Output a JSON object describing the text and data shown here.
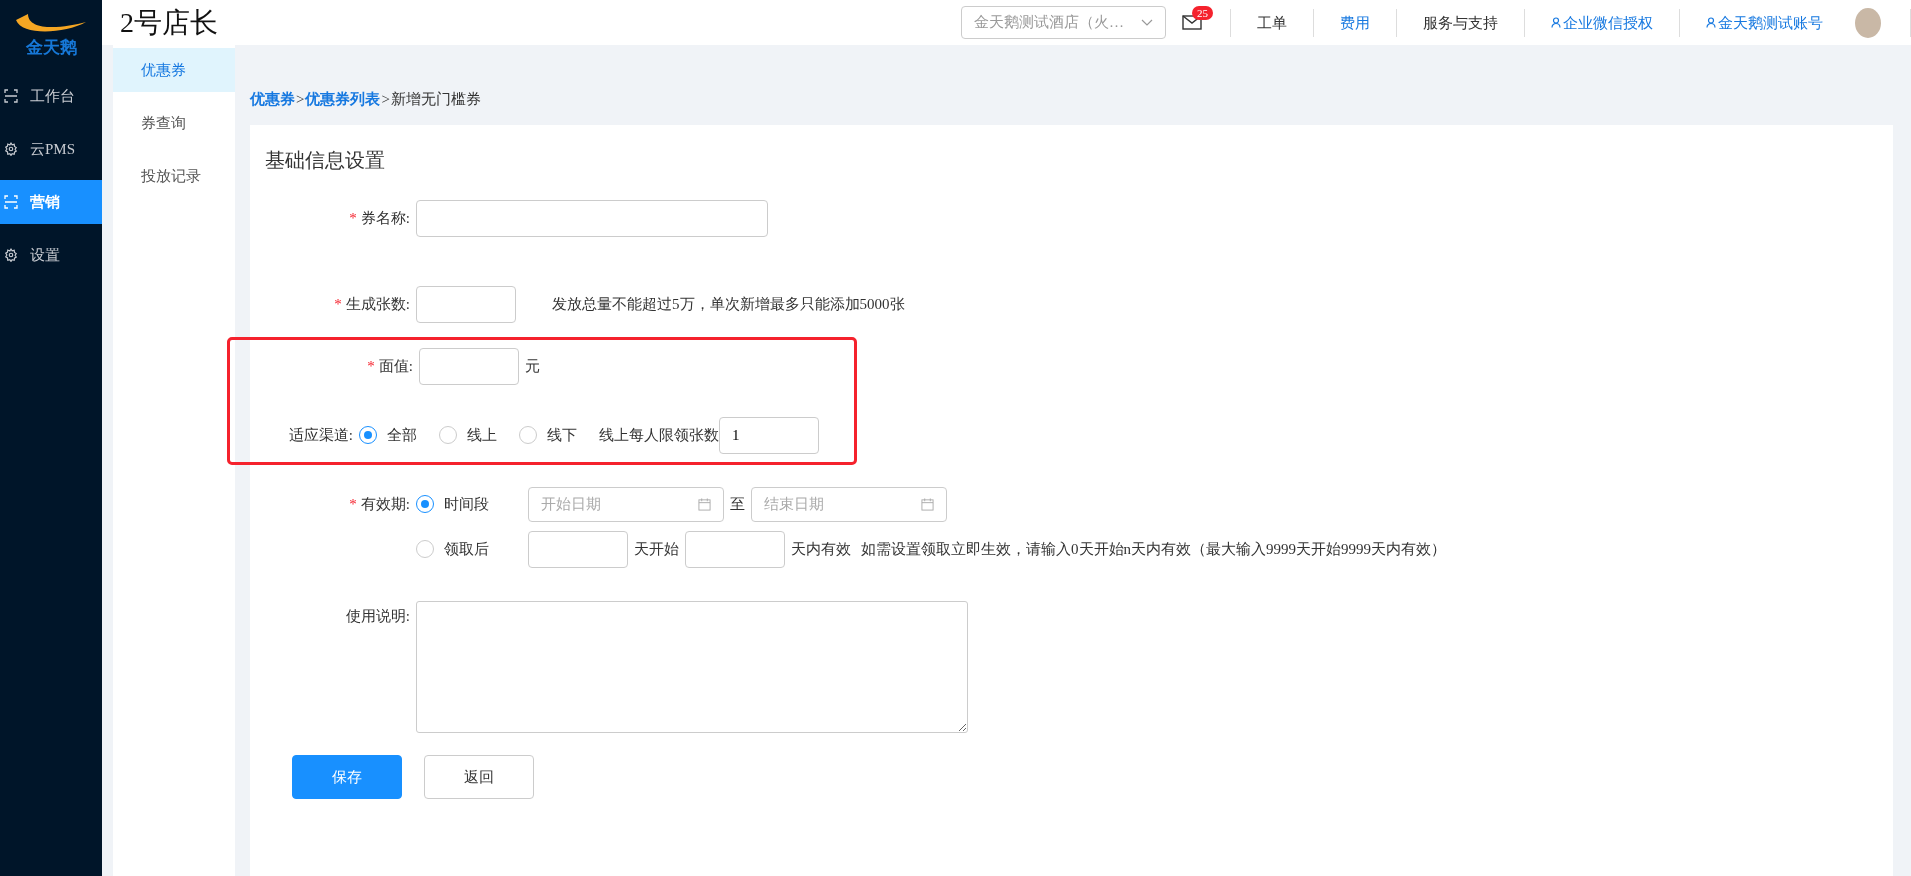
{
  "logo": {
    "text": "金天鹅"
  },
  "app_title": "2号店长",
  "header": {
    "store_select": {
      "value": "金天鹅测试酒店（火…"
    },
    "mail_badge": "25",
    "links": [
      {
        "label": "工单",
        "kind": "plain"
      },
      {
        "label": "费用",
        "kind": "active"
      },
      {
        "label": "服务与支持",
        "kind": "plain"
      },
      {
        "label": "企业微信授权",
        "kind": "user"
      },
      {
        "label": "金天鹅测试账号",
        "kind": "user"
      }
    ]
  },
  "sidebar": {
    "items": [
      {
        "label": "工作台",
        "kind": "scan",
        "selected": false
      },
      {
        "label": "云PMS",
        "kind": "gear",
        "selected": false
      },
      {
        "label": "营销",
        "kind": "scan",
        "selected": true
      },
      {
        "label": "设置",
        "kind": "gear",
        "selected": false
      }
    ]
  },
  "submenu": {
    "items": [
      {
        "label": "优惠券",
        "selected": true
      },
      {
        "label": "券查询",
        "selected": false
      },
      {
        "label": "投放记录",
        "selected": false
      }
    ]
  },
  "breadcrumb_separator": ">",
  "breadcrumb": [
    {
      "label": "优惠券",
      "kind": "link"
    },
    {
      "label": "优惠券列表",
      "kind": "link"
    },
    {
      "label": "新增无门槛券",
      "kind": "current"
    }
  ],
  "form": {
    "title": "基础信息设置",
    "required_mark": "*",
    "name": {
      "label": "券名称:",
      "required": true
    },
    "count": {
      "label": "生成张数:",
      "required": true,
      "hint": "发放总量不能超过5万，单次新增最多只能添加5000张"
    },
    "value": {
      "label": "面值:",
      "required": true,
      "unit": "元"
    },
    "channel": {
      "label": "适应渠道:",
      "options": [
        {
          "label": "全部",
          "selected": true
        },
        {
          "label": "线上",
          "selected": false
        },
        {
          "label": "线下",
          "selected": false
        }
      ],
      "limit_label": "线上每人限领张数",
      "limit_value": "1"
    },
    "validity": {
      "label": "有效期:",
      "required": true,
      "range": {
        "label": "时间段",
        "selected": true,
        "start_placeholder": "开始日期",
        "separator": "至",
        "end_placeholder": "结束日期"
      },
      "after": {
        "label": "领取后",
        "selected": false,
        "text_1": "天开始",
        "text_2": "天内有效",
        "hint": "如需设置领取立即生效，请输入0天开始n天内有效（最大输入9999天开始9999天内有效）"
      }
    },
    "notes": {
      "label": "使用说明:"
    },
    "buttons": [
      {
        "label": "保存",
        "kind": "primary"
      },
      {
        "label": "返回",
        "kind": "default"
      }
    ]
  }
}
